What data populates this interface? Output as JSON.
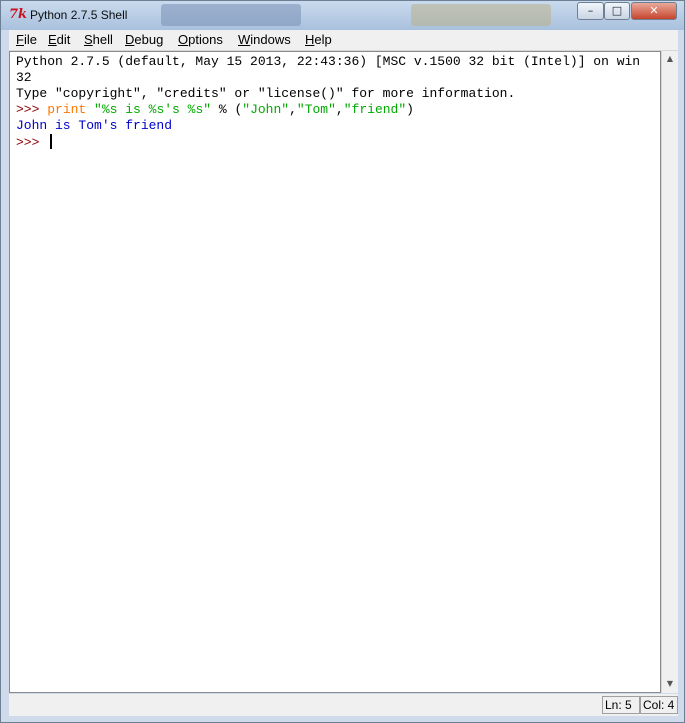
{
  "window": {
    "title": "Python 2.7.5 Shell"
  },
  "titlebar_buttons": {
    "minimize": "–",
    "maximize": "□",
    "close": "✕"
  },
  "menu": [
    {
      "label": "File",
      "mnemonic": "F",
      "rest": "ile"
    },
    {
      "label": "Edit",
      "mnemonic": "E",
      "rest": "dit"
    },
    {
      "label": "Shell",
      "mnemonic": "S",
      "rest": "hell"
    },
    {
      "label": "Debug",
      "mnemonic": "D",
      "rest": "ebug"
    },
    {
      "label": "Options",
      "mnemonic": "O",
      "rest": "ptions"
    },
    {
      "label": "Windows",
      "mnemonic": "W",
      "rest": "indows"
    },
    {
      "label": "Help",
      "mnemonic": "H",
      "rest": "elp"
    }
  ],
  "shell": {
    "banner_line1": "Python 2.7.5 (default, May 15 2013, 22:43:36) [MSC v.1500 32 bit (Intel)] on win",
    "banner_line2": "32",
    "banner_line3": "Type \"copyright\", \"credits\" or \"license()\" for more information.",
    "prompt": ">>> ",
    "cmd_keyword": "print",
    "cmd_string": " \"%s is %s's %s\"",
    "cmd_operator": " % (",
    "arg1": "\"John\"",
    "comma": ",",
    "arg2": "\"Tom\"",
    "arg3": "\"friend\"",
    "close_paren": ")",
    "output": "John is Tom's friend",
    "prompt2": ">>> "
  },
  "status": {
    "line": "Ln: 5",
    "col": "Col: 4"
  },
  "colors": {
    "prompt": "#8b0000",
    "keyword": "#ff7700",
    "string": "#00aa00",
    "output": "#0000cc"
  }
}
